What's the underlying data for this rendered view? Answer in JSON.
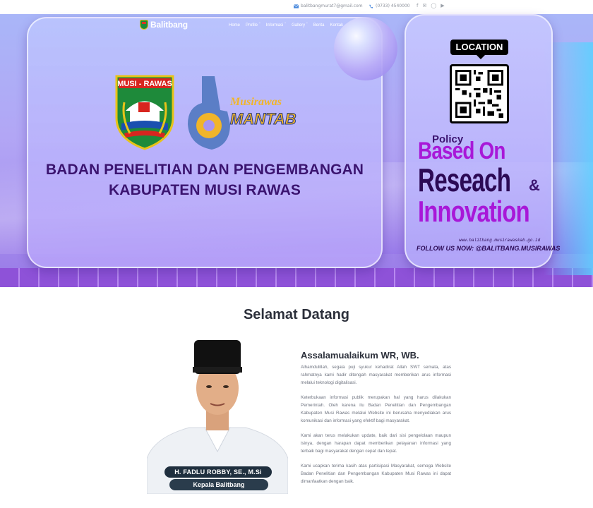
{
  "topbar": {
    "email": "balitbangmurat7@gmail.com",
    "phone": "(0733) 4540000",
    "social_icons": [
      "facebook-icon",
      "twitter-icon",
      "instagram-icon",
      "youtube-icon"
    ]
  },
  "nav": {
    "brand": "Balitbang",
    "items": [
      "Home",
      "Profile",
      "Informasi",
      "Gallery",
      "Berita",
      "Kontak"
    ],
    "has_dropdown": [
      false,
      true,
      true,
      true,
      false,
      false
    ]
  },
  "hero": {
    "shield_label": "MUSI - RAWAS",
    "mantab_line1": "Musirawas",
    "mantab_line2": "MANTAB",
    "title_line1": "BADAN PENELITIAN DAN PENGEMBANGAN",
    "title_line2": "KABUPATEN MUSI RAWAS"
  },
  "poster": {
    "location": "LOCATION",
    "policy": "Policy",
    "based_on": "Based On",
    "research": "Reseach",
    "amp": "&",
    "innovation": "Innovation",
    "url": "www.balitbang.musirawaskab.go.id",
    "follow": "FOLLOW US NOW: @BALITBANG.MUSIRAWAS"
  },
  "welcome": {
    "title": "Selamat Datang",
    "name": "H. FADLU ROBBY, SE., M.Si",
    "role": "Kepala Balitbang",
    "greeting": "Assalamualaikum WR, WB.",
    "paragraphs": [
      "Alhamdulillah, segala puji syukur kehadirat Allah SWT semata, atas rahmatnya kami hadir ditengah masyarakat memberikan arus informasi melalui teknologi digitalisasi.",
      "Keterbukaan informasi publik merupakan hal yang harus dilakukan Pemerintah. Oleh karena itu Badan Penelitian dan Pengembangan Kabupaten Musi Rawas melalui Website ini berusaha menyediakan arus komunikasi dan informasi yang efektif bagi masyarakat.",
      "Kami akan terus melakukan update, baik dari sisi pengelolaan maupun isinya, dengan harapan dapat memberikan pelayanan informasi yang terbaik bagi masyarakat dengan cepat dan tepat.",
      "Kami ucapkan terima kasih atas partisipasi Masyarakat, semoga Website Badan Penelitian dan Pengembangan Kabupaten Musi Rawas ini dapat dimanfaatkan dengan baik."
    ]
  },
  "colors": {
    "hero_title": "#3b1470",
    "accent_purple": "#a818d8",
    "name_plate": "#1f2f3e"
  }
}
